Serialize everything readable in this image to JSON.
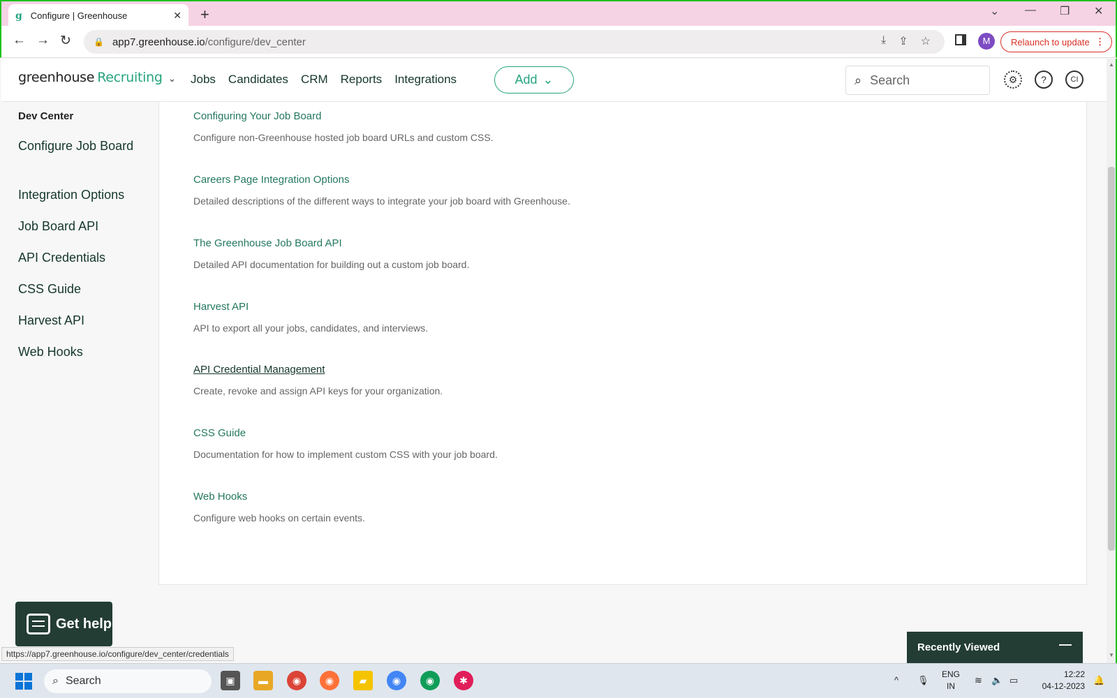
{
  "browser": {
    "tab_title": "Configure | Greenhouse",
    "url_host": "app7.greenhouse.io",
    "url_path": "/configure/dev_center",
    "profile_initial": "M",
    "relaunch_label": "Relaunch to update",
    "status_url": "https://app7.greenhouse.io/configure/dev_center/credentials"
  },
  "header": {
    "logo_text": "greenhouse",
    "logo_product": "Recruiting",
    "nav": [
      "Jobs",
      "Candidates",
      "CRM",
      "Reports",
      "Integrations"
    ],
    "add_label": "Add",
    "search_placeholder": "Search",
    "user_initials": "CI"
  },
  "sidebar": {
    "title": "Dev Center",
    "items": [
      "Configure Job Board",
      "Integration Options",
      "Job Board API",
      "API Credentials",
      "CSS Guide",
      "Harvest API",
      "Web Hooks"
    ]
  },
  "entries": [
    {
      "title": "Configuring Your Job Board",
      "desc": "Configure non-Greenhouse hosted job board URLs and custom CSS."
    },
    {
      "title": "Careers Page Integration Options",
      "desc": "Detailed descriptions of the different ways to integrate your job board with Greenhouse."
    },
    {
      "title": "The Greenhouse Job Board API",
      "desc": "Detailed API documentation for building out a custom job board."
    },
    {
      "title": "Harvest API",
      "desc": "API to export all your jobs, candidates, and interviews."
    },
    {
      "title": "API Credential Management",
      "desc": "Create, revoke and assign API keys for your organization."
    },
    {
      "title": "CSS Guide",
      "desc": "Documentation for how to implement custom CSS with your job board."
    },
    {
      "title": "Web Hooks",
      "desc": "Configure web hooks on certain events."
    }
  ],
  "widgets": {
    "get_help": "Get help",
    "recently_viewed": "Recently Viewed"
  },
  "taskbar": {
    "search_label": "Search",
    "lang_line1": "ENG",
    "lang_line2": "IN",
    "time": "12:22",
    "date": "04-12-2023"
  },
  "colors": {
    "brand_green": "#24a47f",
    "dark_green": "#233d35"
  }
}
